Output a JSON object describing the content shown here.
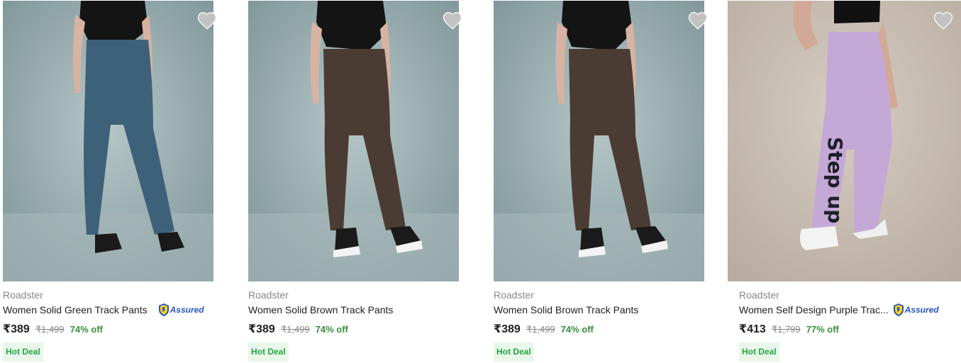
{
  "products": [
    {
      "brand": "Roadster",
      "title": "Women Solid Green Track Pants",
      "price": "₹389",
      "mrp": "₹1,499",
      "discount": "74% off",
      "badge": "Hot Deal",
      "assured_label": "Assured",
      "pant_color": "#3d6178",
      "bg_color": "#9bb0b3",
      "image_alt": "Women wearing solid green track pants"
    },
    {
      "brand": "Roadster",
      "title": "Women Solid Brown Track Pants",
      "price": "₹389",
      "mrp": "₹1,499",
      "discount": "74% off",
      "badge": "Hot Deal",
      "pant_color": "#4a3c33",
      "bg_color": "#9bb0b3",
      "image_alt": "Women wearing solid brown track pants"
    },
    {
      "brand": "Roadster",
      "title": "Women Solid Brown Track Pants",
      "price": "₹389",
      "mrp": "₹1,499",
      "discount": "74% off",
      "badge": "Hot Deal",
      "pant_color": "#4a3c33",
      "bg_color": "#9bb0b3",
      "image_alt": "Women wearing solid brown track pants"
    },
    {
      "brand": "Roadster",
      "title": "Women Self Design Purple Trac...",
      "price": "₹413",
      "mrp": "₹1,799",
      "discount": "77% off",
      "badge": "Hot Deal",
      "assured_label": "Assured",
      "pant_color": "#c4a9d6",
      "bg_color": "#cbc0b5",
      "print_text": "Step up",
      "image_alt": "Women wearing purple self design track pants"
    }
  ],
  "colors": {
    "wishlist": "#c2c2c2",
    "discount": "#388e3c",
    "assured_blue": "#2455c3",
    "deal_bg": "#e8f7ea",
    "deal_text": "#26a541"
  }
}
